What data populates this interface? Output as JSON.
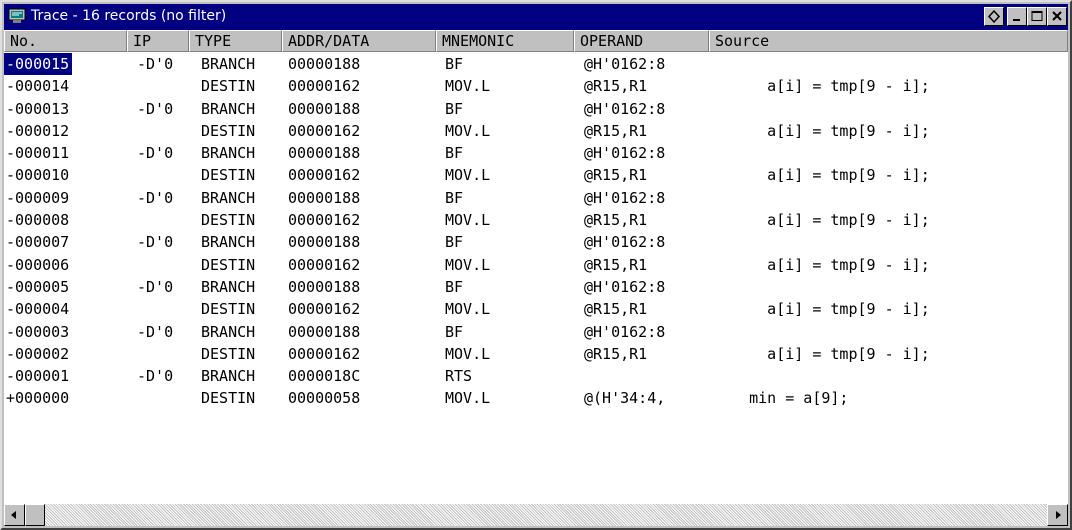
{
  "window": {
    "title": "Trace - 16 records (no filter)",
    "title_bg": "#000080",
    "icons": {
      "app": "trace-window-icon",
      "restore": "restore-icon",
      "minimize": "minimize-icon",
      "maximize": "maximize-icon",
      "close": "close-icon"
    }
  },
  "columns": [
    {
      "key": "no",
      "label": "No."
    },
    {
      "key": "ip",
      "label": "IP"
    },
    {
      "key": "type",
      "label": "TYPE"
    },
    {
      "key": "addr",
      "label": "ADDR/DATA"
    },
    {
      "key": "mnemonic",
      "label": "MNEMONIC"
    },
    {
      "key": "operand",
      "label": "OPERAND"
    },
    {
      "key": "source",
      "label": "Source"
    }
  ],
  "selected_row": 0,
  "rows": [
    {
      "no": "-000015",
      "ip": "-D'0",
      "type": "BRANCH",
      "addr": "00000188",
      "mnemonic": "BF",
      "operand": "@H'0162:8",
      "source": ""
    },
    {
      "no": "-000014",
      "ip": "",
      "type": "DESTIN",
      "addr": "00000162",
      "mnemonic": "MOV.L",
      "operand": "@R15,R1",
      "source": "      a[i] = tmp[9 - i];"
    },
    {
      "no": "-000013",
      "ip": "-D'0",
      "type": "BRANCH",
      "addr": "00000188",
      "mnemonic": "BF",
      "operand": "@H'0162:8",
      "source": ""
    },
    {
      "no": "-000012",
      "ip": "",
      "type": "DESTIN",
      "addr": "00000162",
      "mnemonic": "MOV.L",
      "operand": "@R15,R1",
      "source": "      a[i] = tmp[9 - i];"
    },
    {
      "no": "-000011",
      "ip": "-D'0",
      "type": "BRANCH",
      "addr": "00000188",
      "mnemonic": "BF",
      "operand": "@H'0162:8",
      "source": ""
    },
    {
      "no": "-000010",
      "ip": "",
      "type": "DESTIN",
      "addr": "00000162",
      "mnemonic": "MOV.L",
      "operand": "@R15,R1",
      "source": "      a[i] = tmp[9 - i];"
    },
    {
      "no": "-000009",
      "ip": "-D'0",
      "type": "BRANCH",
      "addr": "00000188",
      "mnemonic": "BF",
      "operand": "@H'0162:8",
      "source": ""
    },
    {
      "no": "-000008",
      "ip": "",
      "type": "DESTIN",
      "addr": "00000162",
      "mnemonic": "MOV.L",
      "operand": "@R15,R1",
      "source": "      a[i] = tmp[9 - i];"
    },
    {
      "no": "-000007",
      "ip": "-D'0",
      "type": "BRANCH",
      "addr": "00000188",
      "mnemonic": "BF",
      "operand": "@H'0162:8",
      "source": ""
    },
    {
      "no": "-000006",
      "ip": "",
      "type": "DESTIN",
      "addr": "00000162",
      "mnemonic": "MOV.L",
      "operand": "@R15,R1",
      "source": "      a[i] = tmp[9 - i];"
    },
    {
      "no": "-000005",
      "ip": "-D'0",
      "type": "BRANCH",
      "addr": "00000188",
      "mnemonic": "BF",
      "operand": "@H'0162:8",
      "source": ""
    },
    {
      "no": "-000004",
      "ip": "",
      "type": "DESTIN",
      "addr": "00000162",
      "mnemonic": "MOV.L",
      "operand": "@R15,R1",
      "source": "      a[i] = tmp[9 - i];"
    },
    {
      "no": "-000003",
      "ip": "-D'0",
      "type": "BRANCH",
      "addr": "00000188",
      "mnemonic": "BF",
      "operand": "@H'0162:8",
      "source": ""
    },
    {
      "no": "-000002",
      "ip": "",
      "type": "DESTIN",
      "addr": "00000162",
      "mnemonic": "MOV.L",
      "operand": "@R15,R1",
      "source": "      a[i] = tmp[9 - i];"
    },
    {
      "no": "-000001",
      "ip": "-D'0",
      "type": "BRANCH",
      "addr": "0000018C",
      "mnemonic": "RTS",
      "operand": "",
      "source": ""
    },
    {
      "no": "+000000",
      "ip": "",
      "type": "DESTIN",
      "addr": "00000058",
      "mnemonic": "MOV.L",
      "operand": "@(H'34:4,",
      "source": "    min = a[9];"
    }
  ],
  "scrollbar": {
    "left_icon": "scroll-left-icon",
    "right_icon": "scroll-right-icon"
  }
}
